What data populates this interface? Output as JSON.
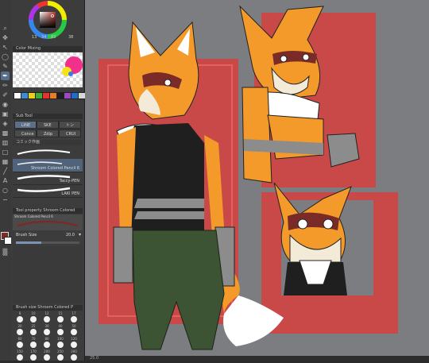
{
  "color_wheel": {
    "values": [
      "13",
      "34",
      "83"
    ],
    "hex": "38"
  },
  "color_mixing": {
    "title": "Color Mixing"
  },
  "sub_tool": {
    "title": "Sub Tool",
    "tabs": [
      {
        "label": "LINE",
        "active": true
      },
      {
        "label": "SKE",
        "active": false
      },
      {
        "label": "トン",
        "active": false
      },
      {
        "label": "Conce",
        "active": false
      },
      {
        "label": "Zdip",
        "active": false
      },
      {
        "label": "CRUI",
        "active": false
      }
    ],
    "header2": "コミック作画",
    "brushes": [
      {
        "label": "",
        "active": false
      },
      {
        "label": "Shroom Colored Pencil 6",
        "active": true
      },
      {
        "label": "Taccy-PEN",
        "active": false
      },
      {
        "label": "LAKI PEN",
        "active": false
      }
    ]
  },
  "tool_property": {
    "title": "Tool property Shroom Colored",
    "preset": "Shroom Colored Pencil 6",
    "brush_size_label": "Brush Size",
    "brush_size_value": "20.0"
  },
  "brush_size_panel": {
    "title": "Brush size Shroom Colored P",
    "sizes": [
      "8",
      "10",
      "12",
      "15",
      "17",
      "20",
      "25",
      "30",
      "40",
      "50",
      "60",
      "70",
      "80",
      "100",
      "120",
      "150",
      "170",
      "200",
      "250",
      "300"
    ]
  },
  "status": {
    "zoom": "25.0"
  },
  "colors": {
    "palette": [
      "#ffffff",
      "#3c8dd8",
      "#e8d21e",
      "#38b030",
      "#e83030",
      "#e87c1e",
      "#1e1e1e",
      "#9a48c8",
      "#1e6ec8",
      "#d8d8d8"
    ],
    "main_color": "#7a2b28",
    "sub_color": "#ffffff",
    "canvas_bg": "#7b7d80",
    "frame_red": "#c94848",
    "fox_orange": "#f39a2a"
  }
}
